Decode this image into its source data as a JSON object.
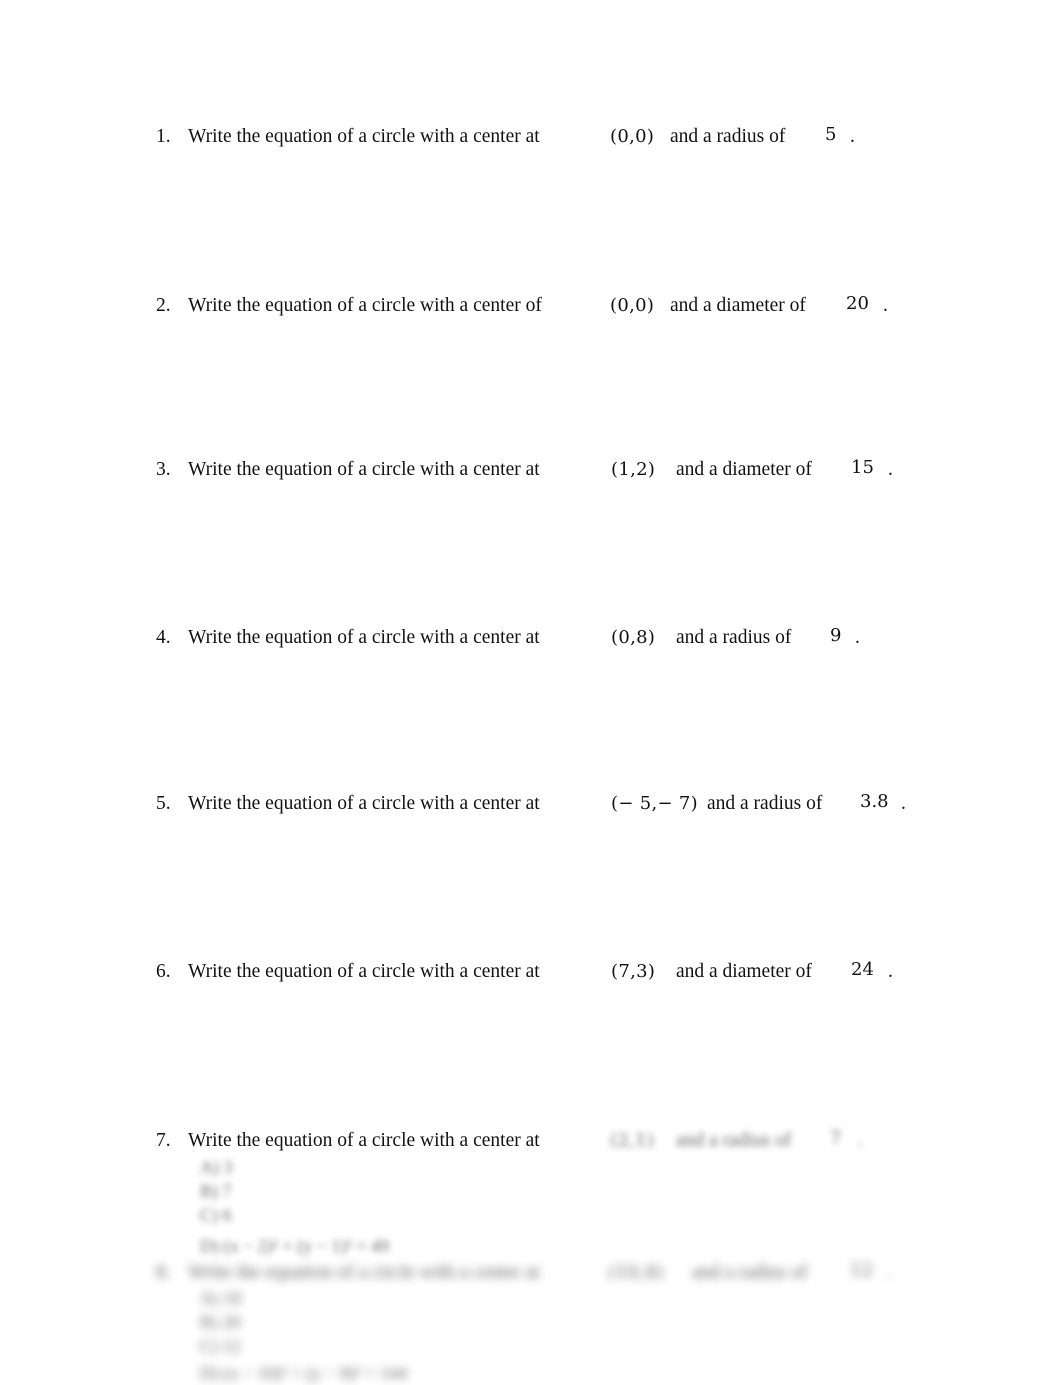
{
  "document": {
    "type": "worksheet",
    "topic": "Equations of circles"
  },
  "problems": [
    {
      "number": "1.",
      "stem": "Write the equation of a circle with a center at",
      "center": "(0,0)",
      "measure_label": "and a radius of",
      "measure_value": "5",
      "end": "."
    },
    {
      "number": "2.",
      "stem": "Write the equation of a circle with a center of",
      "center": "(0,0)",
      "measure_label": "and a diameter of",
      "measure_value": "20",
      "end": "."
    },
    {
      "number": "3.",
      "stem": "Write the equation of a circle with a center at",
      "center": "(1,2)",
      "measure_label": "and a diameter of",
      "measure_value": "15",
      "end": "."
    },
    {
      "number": "4.",
      "stem": "Write the equation of a circle with a center at",
      "center": "(0,8)",
      "measure_label": "and a radius of",
      "measure_value": "9",
      "end": "."
    },
    {
      "number": "5.",
      "stem": "Write the equation of a circle with a center at",
      "center": "(− 5,− 7)",
      "measure_label": "and a radius of",
      "measure_value": "3.8",
      "end": "."
    },
    {
      "number": "6.",
      "stem": "Write the equation of a circle with a center at",
      "center": "(7,3)",
      "measure_label": "and a diameter of",
      "measure_value": "24",
      "end": "."
    },
    {
      "number": "7.",
      "stem": "Write the equation of a circle with a center at",
      "center": "(2,1)",
      "measure_label": "and a radius of",
      "measure_value": "7",
      "end": "."
    }
  ],
  "blurred_content": {
    "problem7_choices": [
      "A) 3",
      "B) 7",
      "C) 6",
      "D) (x − 2)² + (y − 1)² = 49"
    ],
    "problem8": {
      "number": "8.",
      "stem": "Write the equation of a circle with a center at",
      "center": "(10,8)",
      "measure_label": "and a radius of",
      "measure_value": "12",
      "end": ".",
      "choices": [
        "A) 10",
        "B) 20",
        "C) 12",
        "D) (x − 10)² + (y − 8)² = 144"
      ]
    }
  }
}
